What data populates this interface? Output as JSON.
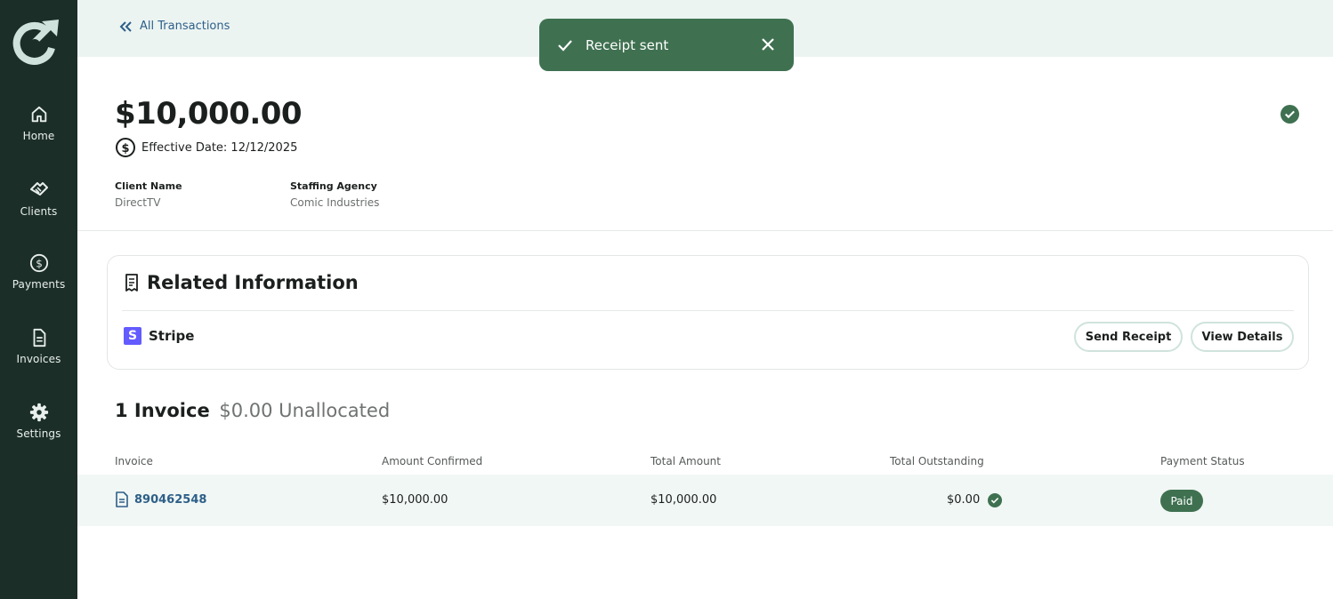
{
  "nav": {
    "items": [
      {
        "label": "Home",
        "icon": "home-icon"
      },
      {
        "label": "Clients",
        "icon": "handshake-icon"
      },
      {
        "label": "Payments",
        "icon": "dollar-circle-icon"
      },
      {
        "label": "Invoices",
        "icon": "document-icon"
      },
      {
        "label": "Settings",
        "icon": "gear-icon"
      }
    ]
  },
  "topbar": {
    "back_label": "All Transactions"
  },
  "toast": {
    "message": "Receipt sent"
  },
  "transaction": {
    "amount": "$10,000.00",
    "effective_date": "Effective Date: 12/12/2025",
    "client_label": "Client Name",
    "client_value": "DirectTV",
    "agency_label": "Staffing Agency",
    "agency_value": "Comic Industries"
  },
  "related": {
    "title": "Related Information",
    "provider": "Stripe",
    "send_receipt": "Send Receipt",
    "view_details": "View Details"
  },
  "invoices": {
    "count_label": "1 Invoice",
    "unallocated": "$0.00 Unallocated",
    "columns": [
      "Invoice",
      "Amount Confirmed",
      "Total Amount",
      "Total Outstanding",
      "Payment Status"
    ],
    "rows": [
      {
        "invoice": "890462548",
        "amount_confirmed": "$10,000.00",
        "total_amount": "$10,000.00",
        "total_outstanding": "$0.00",
        "status": "Paid"
      }
    ]
  },
  "colors": {
    "sidebar": "#1c2e28",
    "accent_green": "#3f7151",
    "link_blue": "#2d5f88",
    "topbar_bg": "#ecf4f2"
  }
}
